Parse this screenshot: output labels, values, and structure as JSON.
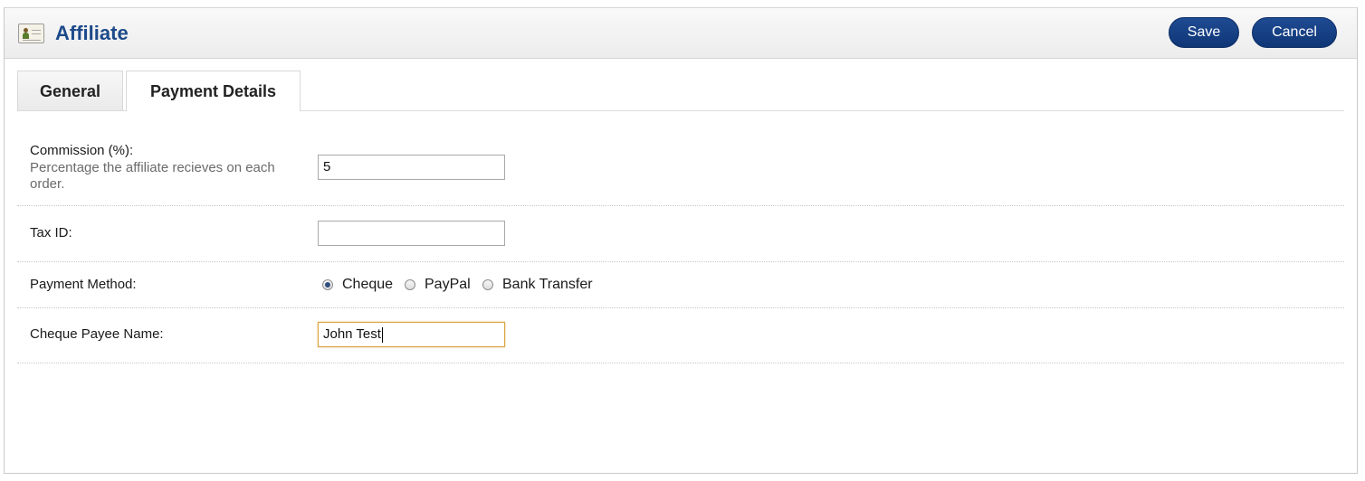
{
  "header": {
    "title": "Affiliate",
    "icon": "affiliate-card-icon",
    "save_label": "Save",
    "cancel_label": "Cancel"
  },
  "tabs": [
    {
      "label": "General",
      "active": false
    },
    {
      "label": "Payment Details",
      "active": true
    }
  ],
  "form": {
    "commission": {
      "label": "Commission (%):",
      "hint": "Percentage the affiliate recieves on each order.",
      "value": "5"
    },
    "tax_id": {
      "label": "Tax ID:",
      "value": ""
    },
    "payment_method": {
      "label": "Payment Method:",
      "options": [
        "Cheque",
        "PayPal",
        "Bank Transfer"
      ],
      "selected": "Cheque"
    },
    "cheque_payee": {
      "label": "Cheque Payee Name:",
      "value": "John Test"
    }
  },
  "colors": {
    "accent": "#1c4a8a",
    "button": "#1a4389",
    "focus_border": "#d9a441"
  }
}
